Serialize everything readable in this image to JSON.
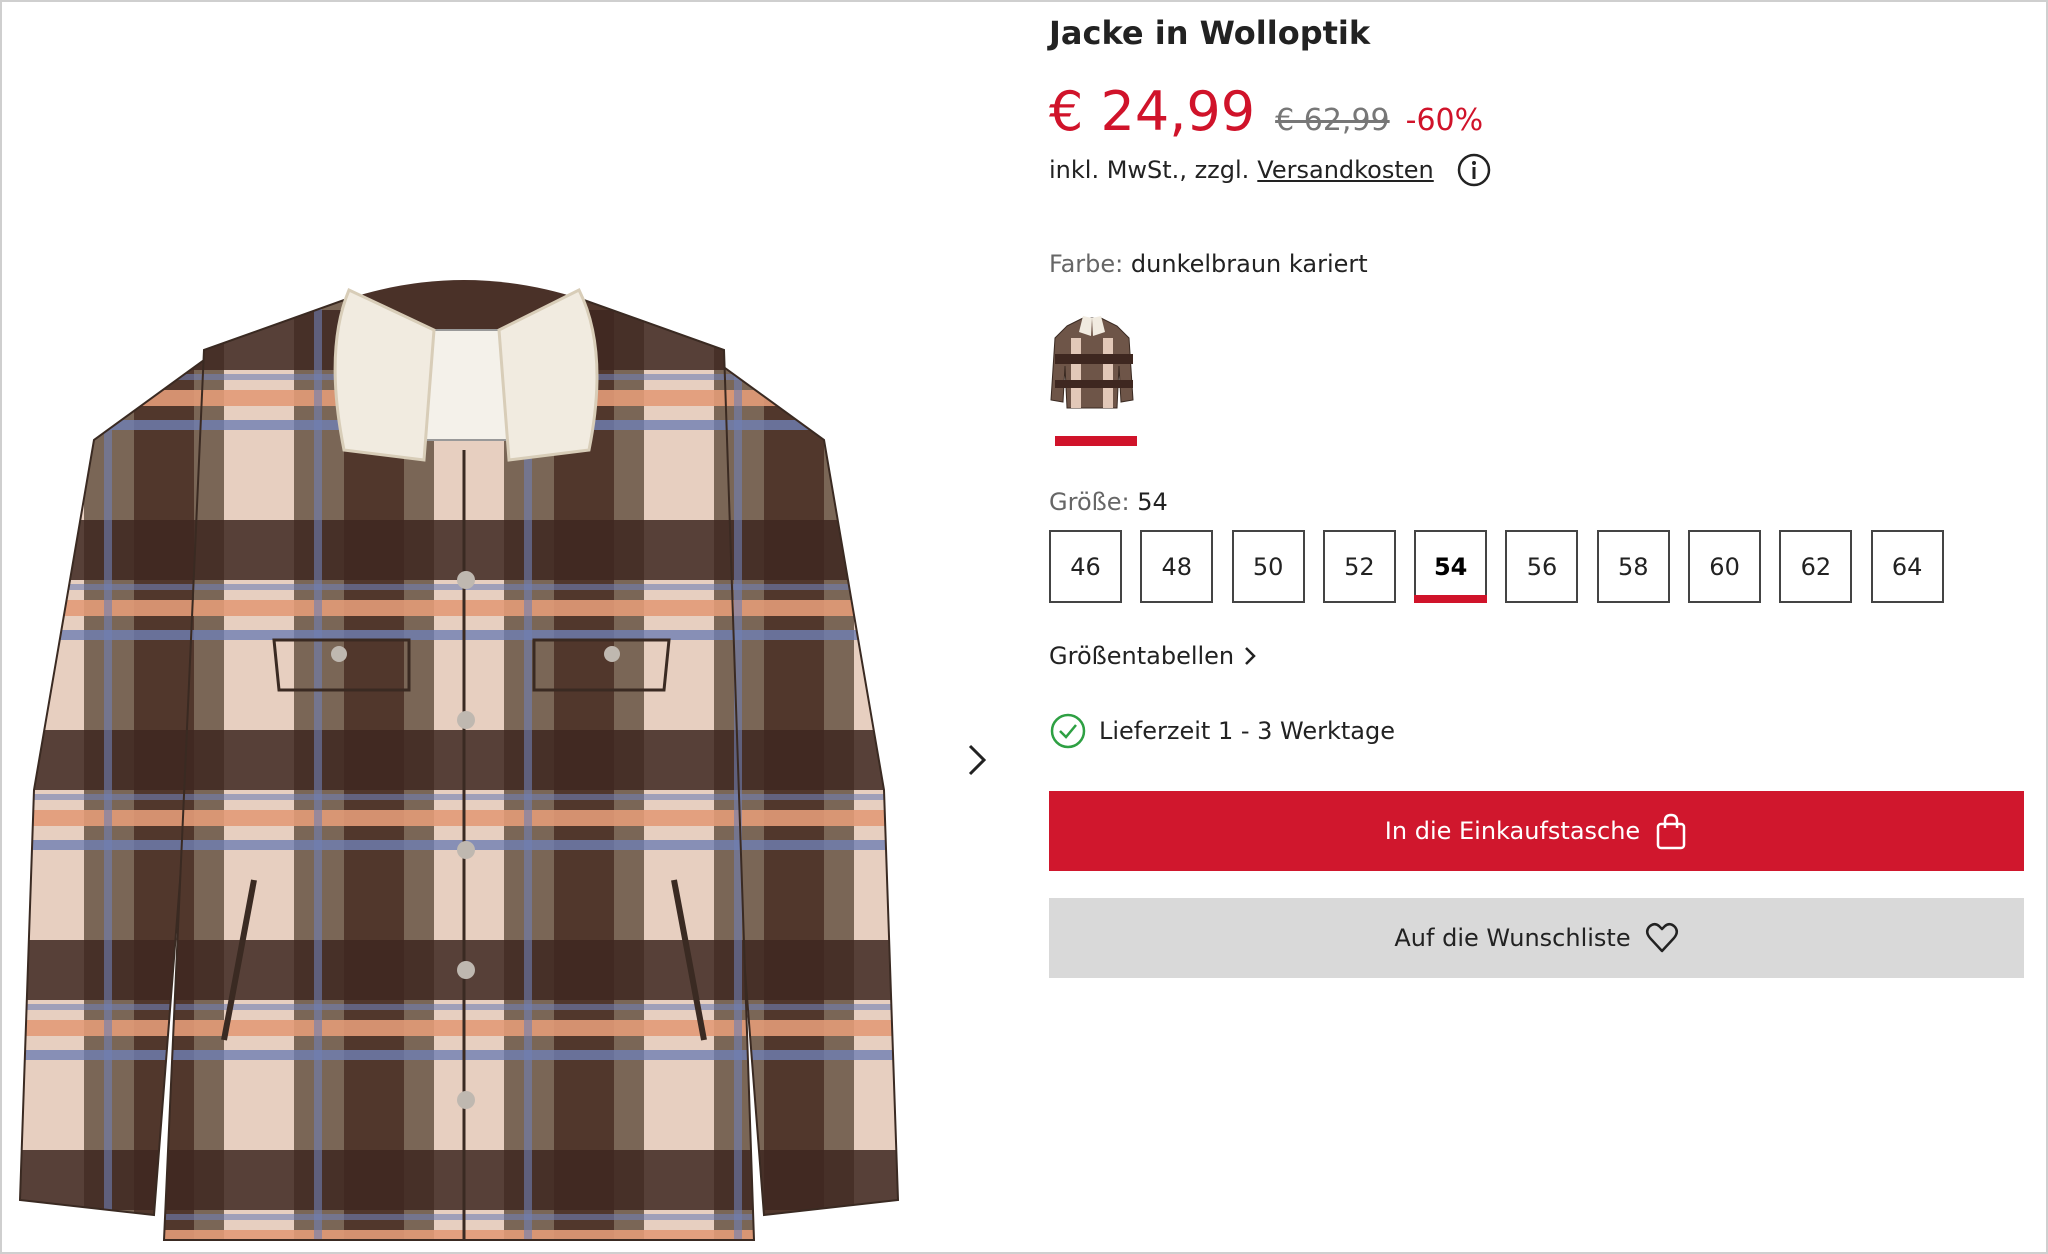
{
  "product": {
    "title": "Jacke in Wolloptik",
    "price": "€ 24,99",
    "old_price": "€ 62,99",
    "discount": "-60%",
    "tax_text": "inkl. MwSt., zzgl.",
    "shipping_link": "Versandkosten"
  },
  "gallery": {
    "image_icon": "plaid-jacket-image",
    "next_icon": "chevron-right-icon"
  },
  "color": {
    "label": "Farbe:",
    "value": "dunkelbraun kariert"
  },
  "size": {
    "label": "Größe:",
    "value": "54",
    "options": [
      "46",
      "48",
      "50",
      "52",
      "54",
      "56",
      "58",
      "60",
      "62",
      "64"
    ],
    "selected": "54"
  },
  "size_chart_link": "Größentabellen",
  "delivery": "Lieferzeit 1 - 3 Werktage",
  "buttons": {
    "add_to_cart": "In die Einkaufstasche",
    "wishlist": "Auf die Wunschliste"
  },
  "colors": {
    "accent": "#d0132a",
    "cart_button": "#d0172d",
    "wishlist_button": "#d9d9d9",
    "delivery_check": "#2ea043"
  }
}
